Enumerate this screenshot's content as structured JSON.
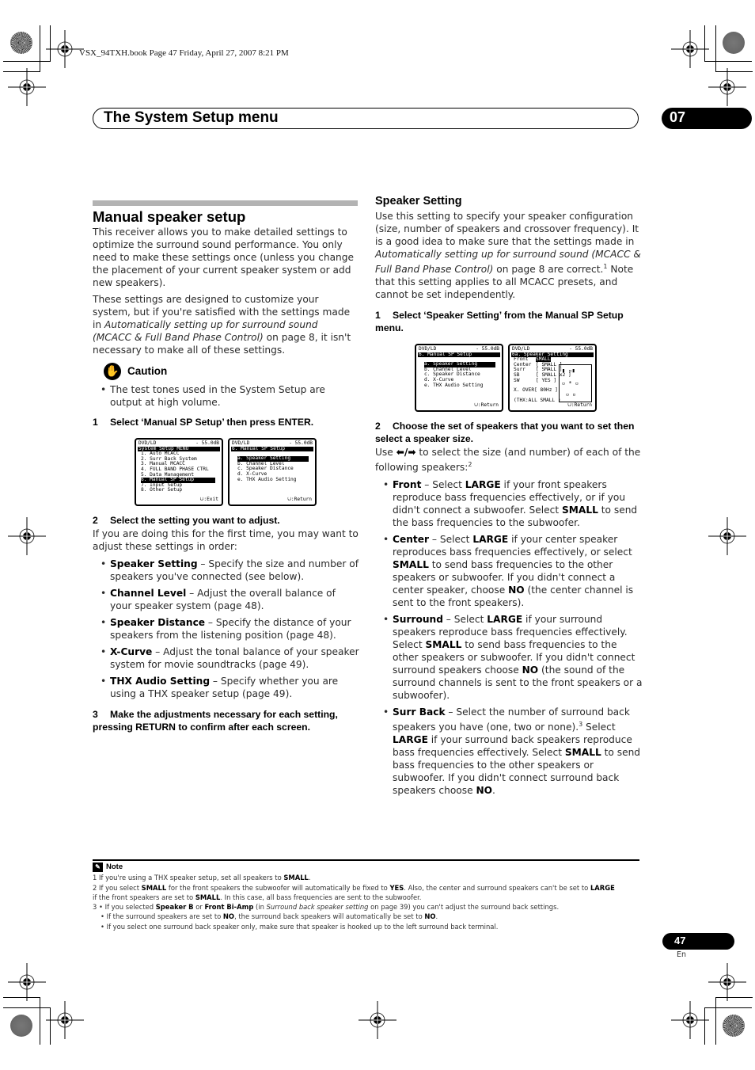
{
  "print_header": "VSX_94TXH.book  Page 47  Friday, April 27, 2007  8:21 PM",
  "chapter": {
    "title": "The System Setup menu",
    "number": "07"
  },
  "left": {
    "heading": "Manual speaker setup",
    "intro_1": "This receiver allows you to make detailed settings to optimize the surround sound performance. You only need to make these settings once (unless you change the placement of your current speaker system or add new speakers).",
    "intro_2_a": "These settings are designed to customize your system, but if you're satisfied with the settings made in ",
    "intro_2_italic": "Automatically setting up for surround sound (MCACC & Full Band Phase Control)",
    "intro_2_b": " on page 8, it isn't necessary to make all of these settings.",
    "caution_label": "Caution",
    "caution_text": "The test tones used in the System Setup are output at high volume.",
    "step1_num": "1",
    "step1": "Select ‘Manual SP Setup’ then press ENTER.",
    "osd1": {
      "source": "DVD/LD",
      "level": "- 55.0dB",
      "title": "System Setup MENU",
      "items": [
        "1. Auto MCACC",
        "2. Surr Back System",
        "3. Manual MCACC",
        "4. FULL BAND PHASE CTRL",
        "5. Data Management",
        "6. Manual SP Setup",
        "7. Input Setup",
        "8. Other Setup"
      ],
      "footer": ":Exit"
    },
    "osd2": {
      "source": "DVD/LD",
      "level": "- 55.0dB",
      "title": "6. Manual SP Setup",
      "items": [
        "a. Speaker Setting",
        "b. Channel Level",
        "c. Speaker Distance",
        "d. X-Curve",
        "e. THX Audio Setting"
      ],
      "footer": ":Return"
    },
    "step2_num": "2",
    "step2": "Select the setting you want to adjust.",
    "step2_text": "If you are doing this for the first time, you may want to adjust these settings in order:",
    "settings": [
      {
        "term": "Speaker Setting",
        "desc": " – Specify the size and number of speakers you've connected (see below)."
      },
      {
        "term": "Channel Level",
        "desc": " – Adjust the overall balance of your speaker system (page 48)."
      },
      {
        "term": "Speaker Distance",
        "desc": " – Specify the distance of your speakers from the listening position (page 48)."
      },
      {
        "term": "X-Curve",
        "desc": " – Adjust the tonal balance of your speaker system for movie soundtracks (page 49)."
      },
      {
        "term": "THX Audio Setting",
        "desc": " – Specify whether you are using a THX speaker setup (page 49)."
      }
    ],
    "step3_num": "3",
    "step3": "Make the adjustments necessary for each setting, pressing RETURN to confirm after each screen."
  },
  "right": {
    "heading": "Speaker Setting",
    "intro_a": "Use this setting to specify your speaker configuration (size, number of speakers and crossover frequency). It is a good idea to make sure that the settings made in ",
    "intro_italic": "Automatically setting up for surround sound (MCACC & Full Band Phase Control)",
    "intro_b": " on page 8 are correct.",
    "intro_sup": "1",
    "intro_c": " Note that this setting applies to all MCACC presets, and cannot be set independently.",
    "step1_num": "1",
    "step1": "Select ‘Speaker Setting’ from the Manual SP Setup menu.",
    "osd3": {
      "source": "DVD/LD",
      "level": "- 55.0dB",
      "title": "6. Manual SP Setup",
      "items": [
        "a. Speaker Setting",
        "b. Channel Level",
        "c. Speaker Distance",
        "d. X-Curve",
        "e. THX Audio Setting"
      ],
      "footer": ":Return"
    },
    "osd4": {
      "source": "DVD/LD",
      "level": "- 55.0dB",
      "title": "6a. Speaker Setting",
      "rows": [
        {
          "label": "Front",
          "value": "SMALL"
        },
        {
          "label": "Center",
          "value": "[ SMALL ]"
        },
        {
          "label": "Surr",
          "value": "[ SMALL ]"
        },
        {
          "label": "SB",
          "value": "[ SMALL x2 ]"
        },
        {
          "label": "SW",
          "value": "[   YES   ]"
        }
      ],
      "xover_label": "X. OVER",
      "xover_value": "[ 80Hz ]",
      "thx": "(THX:ALL SMALL )",
      "footer": ":Return"
    },
    "step2_num": "2",
    "step2": "Choose the set of speakers that you want to set then select a speaker size.",
    "step2_text_a": "Use ",
    "step2_arrows": "⬅/➡",
    "step2_text_b": " to select the size (and number) of each of the following speakers:",
    "step2_sup": "2",
    "speakers": [
      {
        "term": "Front",
        "parts": [
          " – Select ",
          "LARGE",
          " if your front speakers reproduce bass frequencies effectively, or if you didn't connect a subwoofer. Select ",
          "SMALL",
          " to send the bass frequencies to the subwoofer."
        ]
      },
      {
        "term": "Center",
        "parts": [
          " – Select ",
          "LARGE",
          " if your center speaker reproduces bass frequencies effectively, or select ",
          "SMALL",
          " to send bass frequencies to the other speakers or subwoofer. If you didn't connect a center speaker, choose ",
          "NO",
          " (the center channel is sent to the front speakers)."
        ]
      },
      {
        "term": "Surround",
        "parts": [
          " – Select ",
          "LARGE",
          " if your surround speakers reproduce bass frequencies effectively. Select ",
          "SMALL",
          " to send bass frequencies to the other speakers or subwoofer. If you didn't connect surround speakers choose ",
          "NO",
          " (the sound of the surround channels is sent to the front speakers or a subwoofer)."
        ]
      },
      {
        "term": "Surr Back",
        "parts": [
          " – Select the number of surround back speakers you have (one, two or none).",
          "3",
          " Select ",
          "LARGE",
          " if your surround back speakers reproduce bass frequencies effectively. Select ",
          "SMALL",
          " to send bass frequencies to the other speakers or subwoofer. If you didn't connect surround back speakers choose ",
          "NO",
          "."
        ]
      }
    ]
  },
  "notes": {
    "label": "Note",
    "n1": [
      "1  If you're using a THX speaker setup, set all speakers to ",
      "SMALL",
      "."
    ],
    "n2": [
      "2  If you select ",
      "SMALL",
      " for the front speakers the subwoofer will automatically be fixed to ",
      "YES",
      ". Also, the center and surround speakers can't be set to ",
      "LARGE"
    ],
    "n2b": [
      "if the front speakers are set to ",
      "SMALL",
      ". In this case, all bass frequencies are sent to the subwoofer."
    ],
    "n3a": [
      "3  • If you selected ",
      "Speaker B",
      " or ",
      "Front Bi-Amp",
      " (in ",
      "Surround back speaker setting",
      " on page 39) you can't adjust the surround back settings."
    ],
    "n3b": [
      "• If the surround speakers are set to ",
      "NO",
      ", the surround back speakers will automatically be set to ",
      "NO",
      "."
    ],
    "n3c": "• If you select one surround back speaker only, make sure that speaker is hooked up to the left surround back terminal."
  },
  "footer": {
    "page": "47",
    "lang": "En"
  }
}
